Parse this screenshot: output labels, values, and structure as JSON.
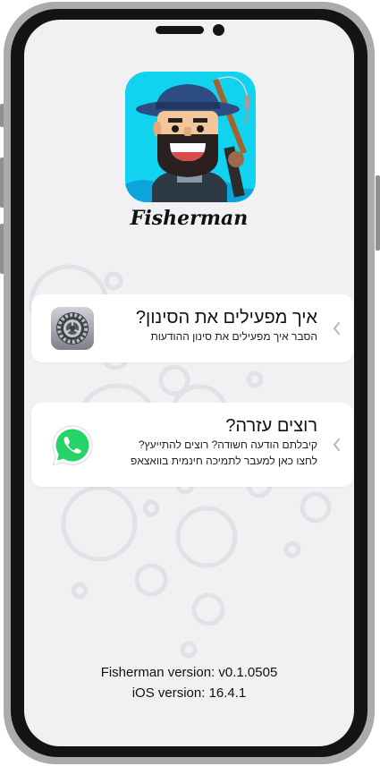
{
  "app": {
    "name": "Fisherman",
    "icon": "fisherman-app-icon"
  },
  "cards": [
    {
      "title": "איך מפעילים את הסינון?",
      "subtitle": "הסבר איך מפעילים את סינון ההודעות",
      "icon": "settings-gear-icon",
      "chevron": "chevron-left-icon"
    },
    {
      "title": "רוצים עזרה?",
      "subtitle_line1": "קיבלתם הודעה חשודה? רוצים להתייעץ?",
      "subtitle_line2": "לחצו כאן למעבר לתמיכה חינמית בוואצאפ",
      "icon": "whatsapp-icon",
      "chevron": "chevron-left-icon"
    }
  ],
  "footer": {
    "app_version": "Fisherman version: v0.1.0505",
    "ios_version": "iOS version: 16.4.1"
  },
  "colors": {
    "screen_background": "#f1f1f4",
    "card_background": "#ffffff",
    "whatsapp_green": "#25d366",
    "icon_cyan": "#12d3ef"
  }
}
